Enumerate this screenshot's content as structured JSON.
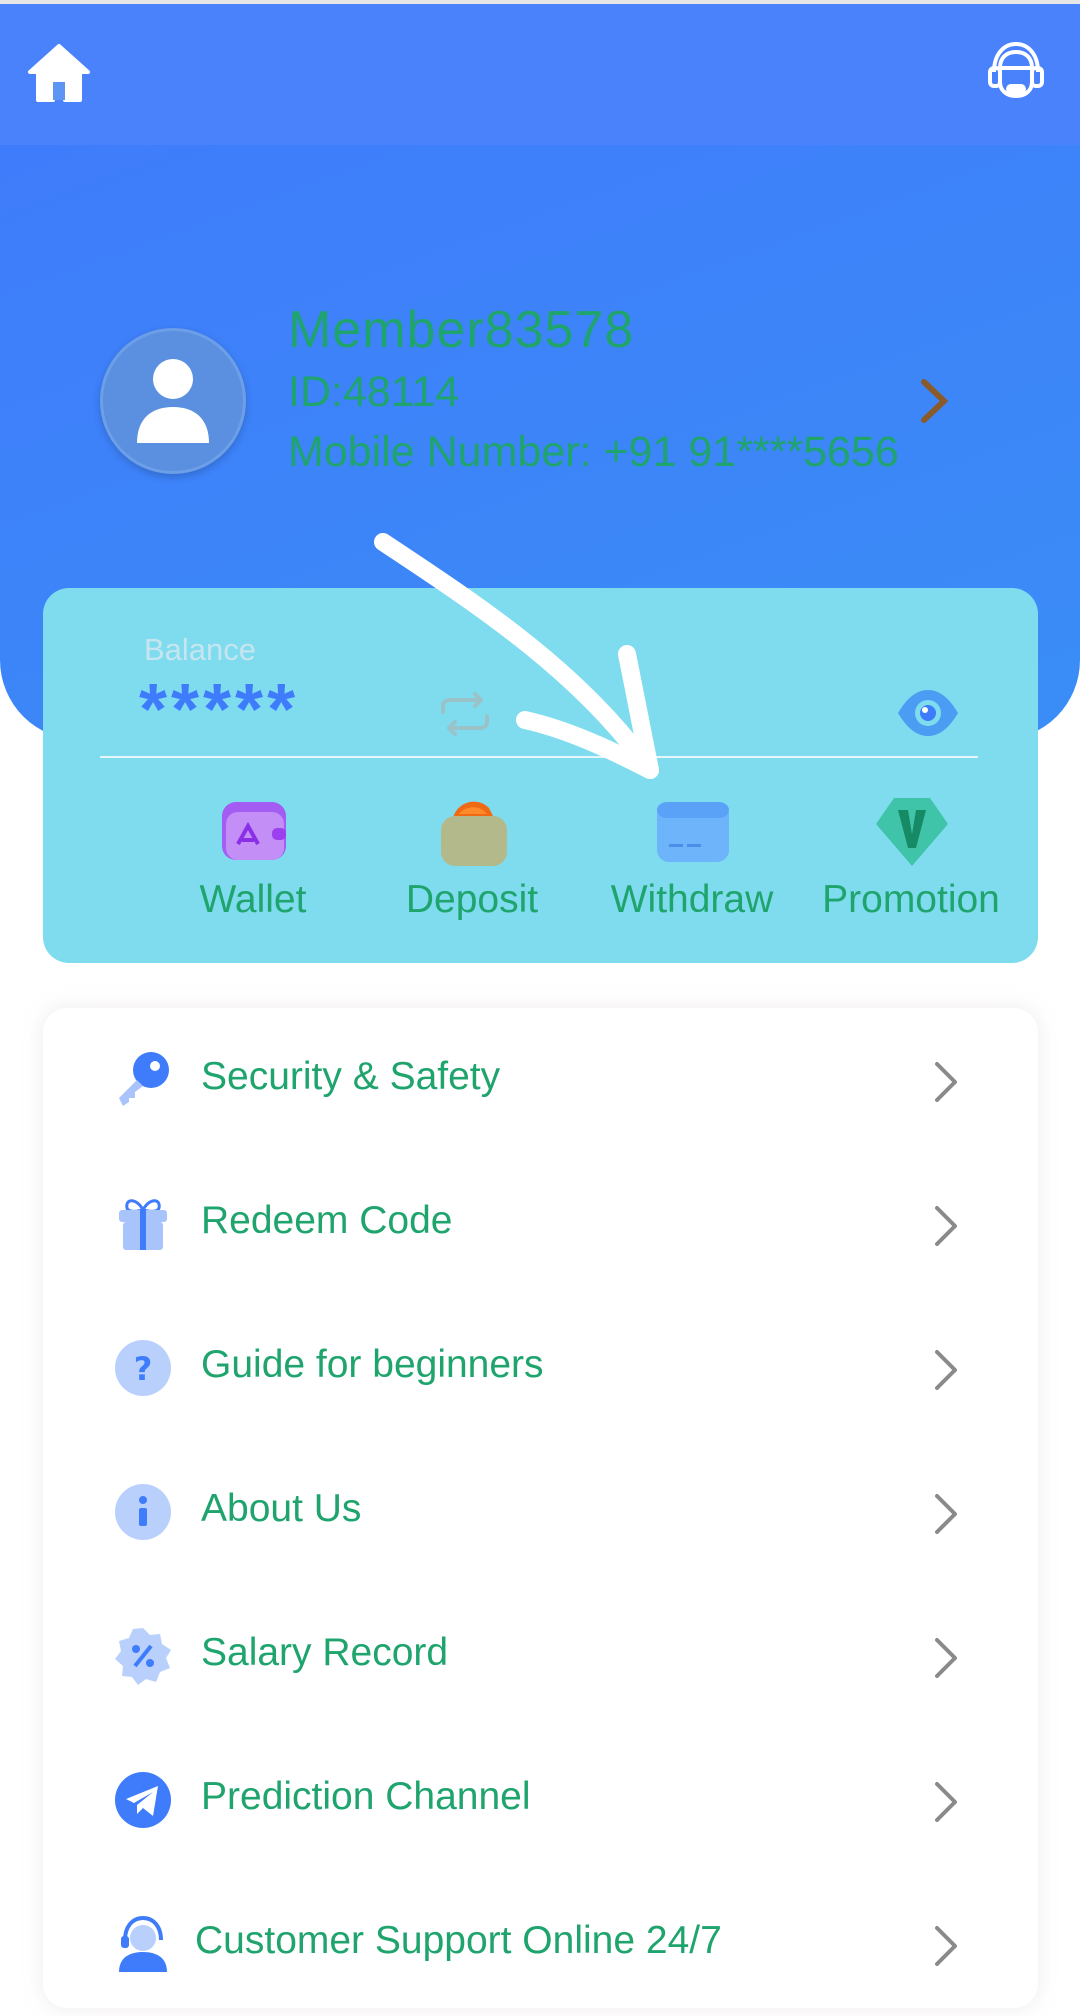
{
  "header": {
    "username": "Member83578",
    "user_id": "ID:48114",
    "mobile": "Mobile Number: +91 91****5656"
  },
  "balance": {
    "label": "Balance",
    "masked_value": "*****"
  },
  "actions": [
    {
      "label": "Wallet",
      "icon": "wallet-icon"
    },
    {
      "label": "Deposit",
      "icon": "deposit-icon"
    },
    {
      "label": "Withdraw",
      "icon": "withdraw-card-icon"
    },
    {
      "label": "Promotion",
      "icon": "promotion-v-icon"
    }
  ],
  "menu": [
    {
      "label": "Security & Safety",
      "icon": "key-icon"
    },
    {
      "label": "Redeem Code",
      "icon": "gift-icon"
    },
    {
      "label": "Guide for beginners",
      "icon": "question-icon"
    },
    {
      "label": "About Us",
      "icon": "info-icon"
    },
    {
      "label": "Salary Record",
      "icon": "percent-badge-icon"
    },
    {
      "label": "Prediction Channel",
      "icon": "telegram-icon"
    },
    {
      "label": "Customer Support Online 24/7",
      "icon": "support-agent-icon"
    }
  ],
  "colors": {
    "header_blue": "#4a82fb",
    "card_cyan": "#7fdcef",
    "text_green": "#1fa46d",
    "icon_blue": "#3f7cfb"
  }
}
